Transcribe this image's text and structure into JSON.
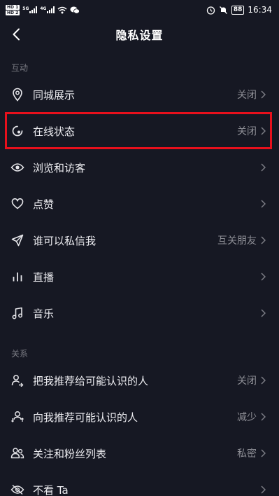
{
  "status_bar": {
    "hd1": "HD 1",
    "hd2": "HD 2",
    "net1": "5G",
    "net2": "4G",
    "battery": "88",
    "time": "16:34"
  },
  "header": {
    "title": "隐私设置"
  },
  "sections": {
    "interaction": "互动",
    "relations": "关系"
  },
  "rows": [
    {
      "label": "同城展示",
      "value": "关闭"
    },
    {
      "label": "在线状态",
      "value": "关闭"
    },
    {
      "label": "浏览和访客",
      "value": ""
    },
    {
      "label": "点赞",
      "value": ""
    },
    {
      "label": "谁可以私信我",
      "value": "互关朋友"
    },
    {
      "label": "直播",
      "value": ""
    },
    {
      "label": "音乐",
      "value": ""
    },
    {
      "label": "把我推荐给可能认识的人",
      "value": "关闭"
    },
    {
      "label": "向我推荐可能认识的人",
      "value": "减少"
    },
    {
      "label": "关注和粉丝列表",
      "value": "私密"
    },
    {
      "label": "不看 Ta",
      "value": ""
    }
  ],
  "icons": {
    "location": "location-pin-icon",
    "online": "online-status-icon",
    "eye": "eye-icon",
    "heart": "heart-icon",
    "send": "paper-plane-icon",
    "live": "live-bars-icon",
    "music": "music-note-icon",
    "recommend_me": "person-share-icon",
    "recommend_to_me": "person-arrows-icon",
    "followers": "people-icon",
    "block": "eye-off-icon",
    "chevron": "chevron-right-icon",
    "back": "back-arrow-icon"
  },
  "colors": {
    "background": "#161823",
    "highlight": "#e8101c",
    "secondary_text": "#8c8d94"
  }
}
